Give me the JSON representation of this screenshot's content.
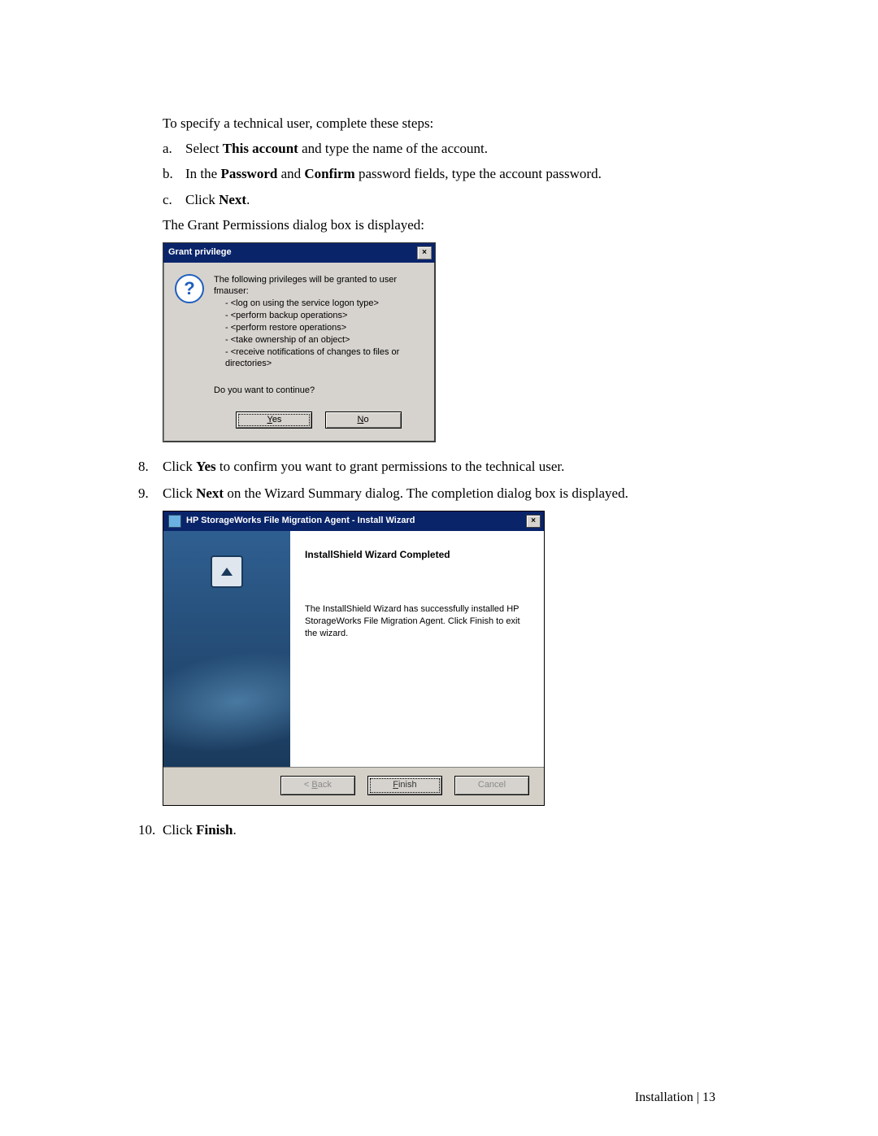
{
  "intro": "To specify a technical user, complete these steps:",
  "steps_letter": [
    {
      "m": "a.",
      "pre": "Select ",
      "b": "This account",
      "post": " and type the name of the account."
    },
    {
      "m": "b.",
      "pre": "In the ",
      "b": "Password",
      "mid": " and ",
      "b2": "Confirm",
      "post": " password fields, type the account password."
    },
    {
      "m": "c.",
      "pre": "Click ",
      "b": "Next",
      "post": "."
    }
  ],
  "after_letter": "The Grant Permissions dialog box is displayed:",
  "dlg1": {
    "title": "Grant privilege",
    "close": "×",
    "line0": "The following privileges will be granted to user fmauser:",
    "lines": [
      "- <log on using the service logon type>",
      "- <perform backup operations>",
      "- <perform restore operations>",
      "- <take ownership of an object>",
      "- <receive notifications of changes to files or directories>"
    ],
    "cont": "Do you want to continue?",
    "yes": "Yes",
    "no": "No"
  },
  "steps_num": {
    "s8": {
      "m": "8.",
      "pre": "Click ",
      "b": "Yes",
      "post": " to confirm you want to grant permissions to the technical user."
    },
    "s9": {
      "m": "9.",
      "pre": "Click ",
      "b": "Next",
      "post": " on the Wizard Summary dialog. The completion dialog box is displayed."
    },
    "s10": {
      "m": "10.",
      "pre": "Click ",
      "b": "Finish",
      "post": "."
    }
  },
  "dlg2": {
    "title": "HP StorageWorks File Migration Agent - Install Wizard",
    "close": "×",
    "heading": "InstallShield Wizard Completed",
    "body": "The InstallShield Wizard has successfully installed HP StorageWorks File Migration Agent. Click Finish to exit the wizard.",
    "back": "< Back",
    "finish": "Finish",
    "cancel": "Cancel"
  },
  "footer": {
    "label": "Installation",
    "sep": " | ",
    "page": "13"
  }
}
